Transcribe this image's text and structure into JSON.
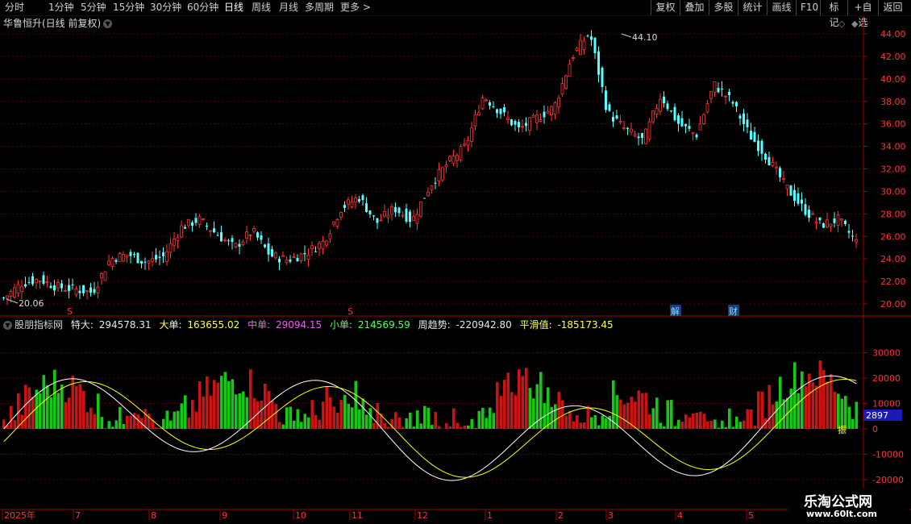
{
  "toolbar": {
    "periods": [
      "分时",
      "1分钟",
      "5分钟",
      "15分钟",
      "30分钟",
      "60分钟",
      "日线",
      "周线",
      "月线",
      "多周期",
      "更多"
    ],
    "active_period": "日线",
    "right_buttons": [
      "复权",
      "叠加",
      "多股",
      "统计",
      "画线",
      "F10",
      "标记",
      "+自选",
      "返回"
    ]
  },
  "chart": {
    "title": "华鲁恒升(日线 前复权)",
    "max_label": "44.10",
    "min_label": "20.06",
    "marker_s": "S",
    "marker_jie": "解",
    "marker_cai": "财",
    "price_ticks": [
      "44.00",
      "42.00",
      "40.00",
      "38.00",
      "36.00",
      "34.00",
      "32.00",
      "30.00",
      "28.00",
      "26.00",
      "24.00",
      "22.00",
      "20.00"
    ],
    "colors": {
      "up": "#ff3232",
      "down": "#54ffff",
      "grid": "#7a0000"
    }
  },
  "indicator": {
    "name": "股朋指标网",
    "items": [
      {
        "label": "特大:",
        "value": "294578.31",
        "color": "#e8e8e8"
      },
      {
        "label": "大单:",
        "value": "163655.02",
        "color": "#ffff55"
      },
      {
        "label": "中单:",
        "value": "29094.15",
        "color": "#ff55ff"
      },
      {
        "label": "小单:",
        "value": "214569.59",
        "color": "#55ff55"
      },
      {
        "label": "周趋势:",
        "value": "-220942.80",
        "color": "#e8e8e8"
      },
      {
        "label": "平滑值:",
        "value": "-185173.45",
        "color": "#ffff55"
      }
    ],
    "ticks": [
      "30000",
      "20000",
      "10000",
      "0",
      "-10000",
      "-20000"
    ],
    "current_value": "2897",
    "zhen": "振",
    "colors": {
      "pos": "#c81414",
      "neg": "#14c814",
      "line1": "#ffffff",
      "line2": "#ffff00"
    }
  },
  "xaxis": {
    "labels": [
      "2025年",
      "7",
      "8",
      "9",
      "10",
      "11",
      "12",
      "1",
      "2",
      "3",
      "4",
      "5"
    ]
  },
  "chart_data": {
    "type": "candlestick",
    "title": "华鲁恒升(日线 前复权)",
    "price_range": [
      20.06,
      44.1
    ],
    "y_ticks": [
      20,
      22,
      24,
      26,
      28,
      30,
      32,
      34,
      36,
      38,
      40,
      42,
      44
    ],
    "close_series": [
      20.5,
      21.8,
      22.2,
      21.5,
      21.3,
      21.0,
      24.0,
      24.4,
      23.7,
      24.2,
      26.8,
      27.5,
      26.2,
      25.0,
      26.5,
      24.3,
      23.9,
      24.5,
      25.5,
      28.5,
      29.5,
      27.2,
      28.5,
      27.4,
      30.5,
      32.5,
      34.0,
      38.5,
      37.0,
      35.5,
      36.5,
      37.5,
      42.0,
      44.1,
      37.0,
      35.5,
      34.5,
      38.5,
      36.0,
      35.0,
      39.5,
      38.0,
      35.0,
      33.0,
      30.5,
      28.5,
      27.0,
      27.5,
      25.5
    ],
    "indicator_range": [
      -27000,
      38000
    ],
    "indicator_ticks": [
      30000,
      20000,
      10000,
      0,
      -10000,
      -20000
    ]
  },
  "footer": {
    "site": "乐淘公式网",
    "url": "www.60lt.com"
  }
}
